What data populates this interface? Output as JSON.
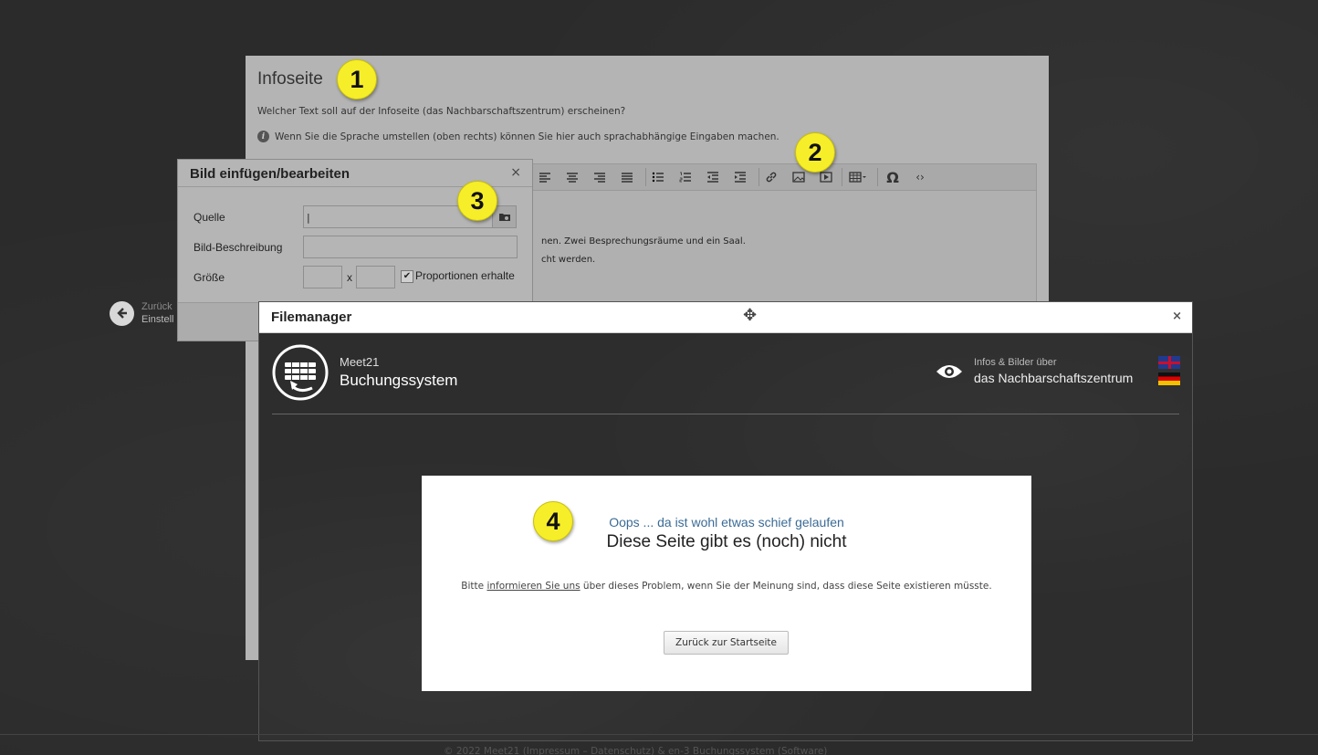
{
  "background": {
    "color": "#2b2b2b"
  },
  "back_link": {
    "line1": "Zurück",
    "line2": "Einstell"
  },
  "info_page": {
    "title": "Infoseite",
    "question": "Welcher Text soll auf der Infoseite (das Nachbarschaftszentrum) erscheinen?",
    "hint": "Wenn Sie die Sprache umstellen (oben rechts) können Sie hier auch sprachabhängige Eingaben machen.",
    "editor_lines": [
      "nen. Zwei Besprechungsräume und ein Saal.",
      "cht werden."
    ],
    "toolbar_icons": [
      "align-left-icon",
      "align-center-icon",
      "align-right-icon",
      "align-justify-icon",
      "bullet-list-icon",
      "numbered-list-icon",
      "outdent-icon",
      "indent-icon",
      "link-icon",
      "image-icon",
      "media-icon",
      "table-icon",
      "special-char-icon",
      "source-code-icon"
    ]
  },
  "image_dialog": {
    "title": "Bild einfügen/bearbeiten",
    "close": "×",
    "source_label": "Quelle",
    "description_label": "Bild-Beschreibung",
    "size_label": "Größe",
    "size_separator": "x",
    "keep_proportions": "Proportionen erhalte",
    "source_value": "|"
  },
  "filemanager": {
    "title": "Filemanager",
    "close": "×",
    "brand_small": "Meet21",
    "brand_big": "Buchungssystem",
    "info_small": "Infos & Bilder über",
    "info_big": "das Nachbarschaftszentrum",
    "error": {
      "subtitle": "Oops ... da ist wohl etwas schief gelaufen",
      "title": "Diese Seite gibt es (noch) nicht",
      "text_before": "Bitte ",
      "text_link": "informieren Sie uns",
      "text_after": " über dieses Problem, wenn Sie der Meinung sind, dass diese Seite existieren müsste.",
      "button": "Zurück zur Startseite"
    }
  },
  "markers": [
    "1",
    "2",
    "3",
    "4"
  ],
  "marker_color": "#f7ee2a",
  "footer": "© 2022 Meet21 (Impressum – Datenschutz) & en-3 Buchungssystem (Software)"
}
